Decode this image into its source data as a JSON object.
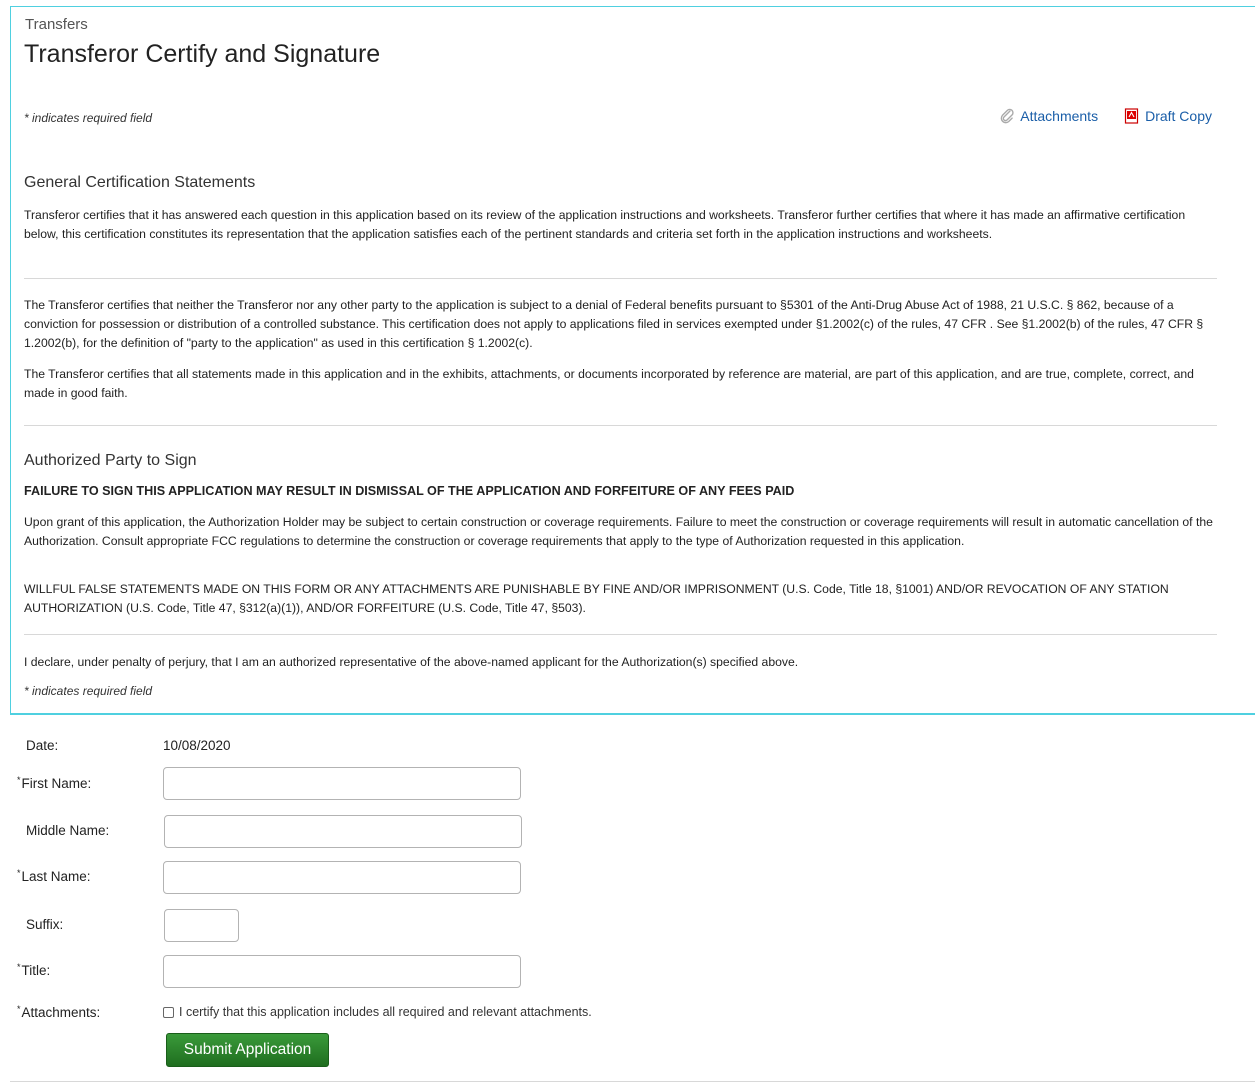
{
  "header": {
    "breadcrumb": "Transfers",
    "title": "Transferor Certify and Signature",
    "required_note": "* indicates required field",
    "attachments_link": "Attachments",
    "draft_copy_link": "Draft Copy"
  },
  "general": {
    "title": "General Certification Statements",
    "p1": "Transferor certifies that it has answered each question in this application based on its review of the application instructions and worksheets. Transferor further certifies that where it has made an affirmative certification below, this certification constitutes its representation that the application satisfies each of the pertinent standards and criteria set forth in the application instructions and worksheets.",
    "p2": "The Transferor certifies that neither the Transferor nor any other party to the application is subject to a denial of Federal benefits pursuant to §5301 of the Anti-Drug Abuse Act of 1988, 21 U.S.C. § 862, because of a conviction for possession or distribution of a controlled substance. This certification does not apply to applications filed in services exempted under §1.2002(c) of the rules, 47 CFR . See §1.2002(b) of the rules, 47 CFR § 1.2002(b), for the definition of \"party to the application\" as used in this certification § 1.2002(c).",
    "p3": "The Transferor certifies that all statements made in this application and in the exhibits, attachments, or documents incorporated by reference are material, are part of this application, and are true, complete, correct, and made in good faith."
  },
  "authorized": {
    "title": "Authorized Party to Sign",
    "warning": "FAILURE TO SIGN THIS APPLICATION MAY RESULT IN DISMISSAL OF THE APPLICATION AND FORFEITURE OF ANY FEES PAID",
    "p1": "Upon grant of this application, the Authorization Holder may be subject to certain construction or coverage requirements. Failure to meet the construction or coverage requirements will result in automatic cancellation of the Authorization. Consult appropriate FCC regulations to determine the construction or coverage requirements that apply to the type of Authorization requested in this application.",
    "p2": "WILLFUL FALSE STATEMENTS MADE ON THIS FORM OR ANY ATTACHMENTS ARE PUNISHABLE BY FINE AND/OR IMPRISONMENT (U.S. Code, Title 18, §1001) AND/OR REVOCATION OF ANY STATION AUTHORIZATION (U.S. Code, Title 47, §312(a)(1)), AND/OR FORFEITURE (U.S. Code, Title 47, §503).",
    "declare": "I declare, under penalty of perjury, that I am an authorized representative of the above-named applicant for the Authorization(s) specified above.",
    "required_note": "* indicates required field"
  },
  "form": {
    "date_label": "Date:",
    "date_value": "10/08/2020",
    "first_name_label": "First Name:",
    "middle_name_label": "Middle Name:",
    "last_name_label": "Last Name:",
    "suffix_label": "Suffix:",
    "title_label": "Title:",
    "attachments_label": "Attachments:",
    "certify_text": "I certify that this application includes all required and relevant attachments.",
    "submit_label": "Submit Application",
    "asterisk": "*"
  }
}
